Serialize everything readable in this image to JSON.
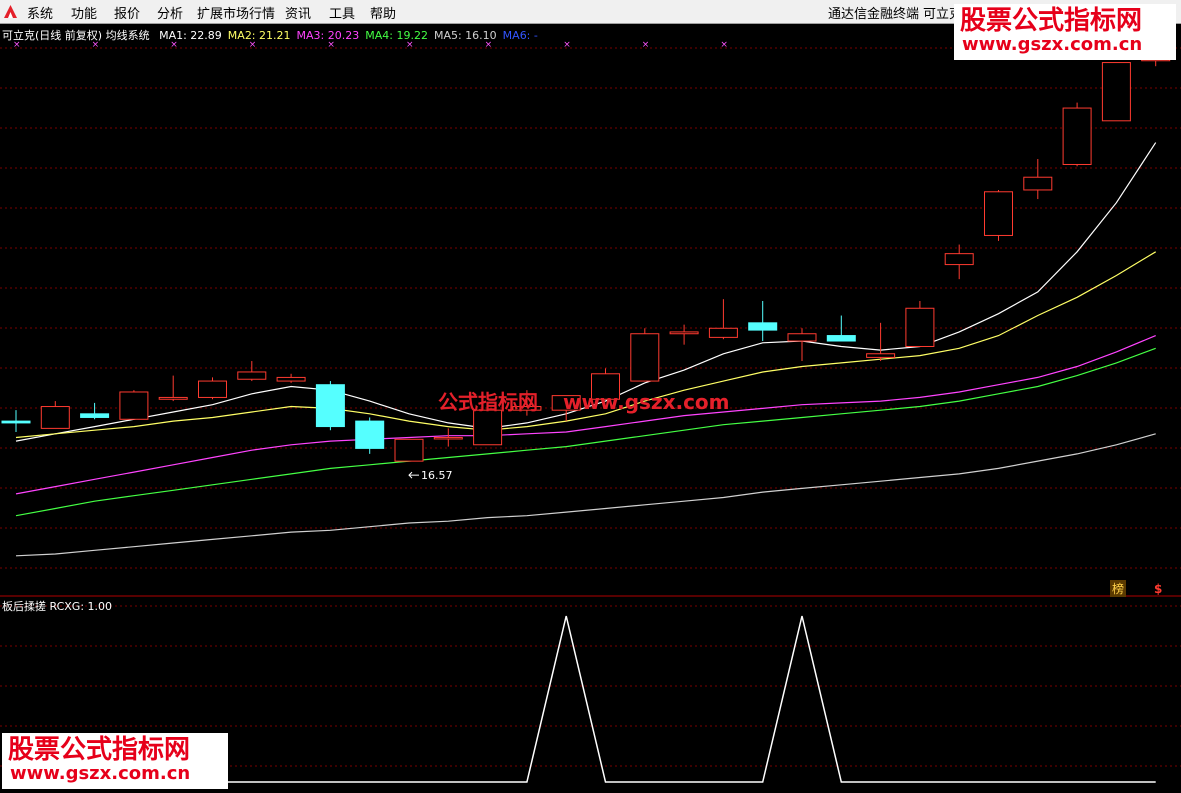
{
  "menu": {
    "items": [
      "系统",
      "功能",
      "报价",
      "分析",
      "扩展市场行情",
      "资讯",
      "工具",
      "帮助"
    ],
    "right_items": [
      "通达信金融终端",
      "可立克"
    ]
  },
  "main_panel": {
    "header_label": "可立克(日线 前复权) 均线系统",
    "ma_legend": [
      {
        "label": "MA1: 22.89",
        "color": "#ffffff"
      },
      {
        "label": "MA2: 21.21",
        "color": "#ffff66"
      },
      {
        "label": "MA3: 20.23",
        "color": "#ff44ff"
      },
      {
        "label": "MA4: 19.22",
        "color": "#44ff44"
      },
      {
        "label": "MA5: 16.10",
        "color": "#d0d0d0"
      },
      {
        "label": "MA6: -",
        "color": "#3355ff"
      }
    ],
    "low_annotation": "16.57",
    "badge_bang": "榜",
    "badge_s": "$"
  },
  "sub_panel": {
    "header_label": "板后揉搓  RCXG: 1.00"
  },
  "watermarks": {
    "title": "股票公式指标网",
    "url": "www.gszx.com.cn",
    "center_a": "公式指标网",
    "center_b": "www.gszx.com"
  },
  "colors": {
    "up": "#ff3b30",
    "down": "#55ffff",
    "grid": "#7a0000",
    "separator": "#b00000"
  },
  "chart_data": [
    {
      "type": "candlestick",
      "y_range": [
        15.0,
        30.0
      ],
      "candles": [
        {
          "o": 19.75,
          "h": 20.05,
          "l": 19.45,
          "c": 19.7
        },
        {
          "o": 19.55,
          "h": 20.3,
          "l": 19.55,
          "c": 20.15
        },
        {
          "o": 19.95,
          "h": 20.25,
          "l": 19.8,
          "c": 19.85
        },
        {
          "o": 19.8,
          "h": 20.6,
          "l": 19.8,
          "c": 20.55
        },
        {
          "o": 20.35,
          "h": 21.0,
          "l": 20.3,
          "c": 20.4
        },
        {
          "o": 20.4,
          "h": 20.95,
          "l": 20.35,
          "c": 20.85
        },
        {
          "o": 20.9,
          "h": 21.4,
          "l": 20.85,
          "c": 21.1
        },
        {
          "o": 20.85,
          "h": 21.05,
          "l": 20.8,
          "c": 20.95
        },
        {
          "o": 20.75,
          "h": 20.85,
          "l": 19.5,
          "c": 19.6
        },
        {
          "o": 19.75,
          "h": 19.85,
          "l": 18.85,
          "c": 19.0
        },
        {
          "o": 18.65,
          "h": 19.25,
          "l": 18.65,
          "c": 19.25
        },
        {
          "o": 19.3,
          "h": 19.55,
          "l": 19.05,
          "c": 19.3
        },
        {
          "o": 19.1,
          "h": 20.2,
          "l": 19.1,
          "c": 20.05
        },
        {
          "o": 20.05,
          "h": 20.6,
          "l": 19.9,
          "c": 20.15
        },
        {
          "o": 20.05,
          "h": 20.45,
          "l": 19.75,
          "c": 20.45
        },
        {
          "o": 20.35,
          "h": 21.2,
          "l": 20.35,
          "c": 21.05
        },
        {
          "o": 20.85,
          "h": 22.3,
          "l": 20.85,
          "c": 22.15
        },
        {
          "o": 22.15,
          "h": 22.4,
          "l": 21.85,
          "c": 22.2
        },
        {
          "o": 22.05,
          "h": 23.1,
          "l": 22.0,
          "c": 22.3
        },
        {
          "o": 22.45,
          "h": 23.05,
          "l": 21.95,
          "c": 22.25
        },
        {
          "o": 21.95,
          "h": 22.3,
          "l": 21.4,
          "c": 22.15
        },
        {
          "o": 22.1,
          "h": 22.65,
          "l": 22.0,
          "c": 21.95
        },
        {
          "o": 21.5,
          "h": 22.45,
          "l": 21.4,
          "c": 21.6
        },
        {
          "o": 21.8,
          "h": 23.05,
          "l": 21.8,
          "c": 22.85
        },
        {
          "o": 24.05,
          "h": 24.6,
          "l": 23.65,
          "c": 24.35
        },
        {
          "o": 24.85,
          "h": 26.1,
          "l": 24.7,
          "c": 26.05
        },
        {
          "o": 26.1,
          "h": 26.95,
          "l": 25.85,
          "c": 26.45
        },
        {
          "o": 26.8,
          "h": 28.5,
          "l": 26.75,
          "c": 28.35
        },
        {
          "o": 28.0,
          "h": 29.6,
          "l": 28.0,
          "c": 29.6
        },
        {
          "o": 29.65,
          "h": 30.7,
          "l": 29.5,
          "c": 30.15
        }
      ],
      "series": [
        {
          "name": "MA1",
          "color": "#ffffff",
          "values": [
            19.2,
            19.4,
            19.6,
            19.8,
            20.0,
            20.2,
            20.5,
            20.7,
            20.6,
            20.3,
            19.95,
            19.7,
            19.55,
            19.7,
            19.95,
            20.3,
            20.8,
            21.15,
            21.6,
            21.9,
            21.95,
            21.8,
            21.7,
            21.8,
            22.2,
            22.7,
            23.3,
            24.4,
            25.75,
            27.4
          ]
        },
        {
          "name": "MA2",
          "color": "#ffff66",
          "values": [
            19.3,
            19.4,
            19.5,
            19.6,
            19.75,
            19.85,
            20.0,
            20.15,
            20.1,
            19.95,
            19.75,
            19.6,
            19.5,
            19.6,
            19.75,
            19.95,
            20.3,
            20.6,
            20.85,
            21.1,
            21.25,
            21.35,
            21.45,
            21.55,
            21.75,
            22.1,
            22.65,
            23.15,
            23.75,
            24.4
          ]
        },
        {
          "name": "MA3",
          "color": "#ff44ff",
          "values": [
            17.75,
            17.95,
            18.15,
            18.35,
            18.55,
            18.75,
            18.95,
            19.1,
            19.2,
            19.25,
            19.3,
            19.35,
            19.35,
            19.4,
            19.45,
            19.6,
            19.75,
            19.9,
            20.0,
            20.1,
            20.2,
            20.25,
            20.3,
            20.4,
            20.55,
            20.75,
            20.95,
            21.25,
            21.65,
            22.1
          ]
        },
        {
          "name": "MA4",
          "color": "#44ff44",
          "values": [
            17.15,
            17.35,
            17.55,
            17.7,
            17.85,
            18.0,
            18.15,
            18.3,
            18.45,
            18.55,
            18.65,
            18.75,
            18.85,
            18.95,
            19.05,
            19.2,
            19.35,
            19.5,
            19.65,
            19.75,
            19.85,
            19.95,
            20.05,
            20.15,
            20.3,
            20.5,
            20.7,
            21.0,
            21.35,
            21.75
          ]
        },
        {
          "name": "MA5",
          "color": "#d0d0d0",
          "values": [
            16.05,
            16.1,
            16.2,
            16.3,
            16.4,
            16.5,
            16.6,
            16.7,
            16.75,
            16.85,
            16.95,
            17.0,
            17.1,
            17.15,
            17.25,
            17.35,
            17.45,
            17.55,
            17.65,
            17.8,
            17.9,
            18.0,
            18.1,
            18.2,
            18.3,
            18.45,
            18.65,
            18.85,
            19.1,
            19.4
          ]
        }
      ]
    },
    {
      "type": "line",
      "name": "RCXG",
      "y_range": [
        0,
        1
      ],
      "values": [
        0,
        0,
        0,
        0,
        0,
        0,
        0,
        0,
        0,
        0,
        0,
        0,
        0,
        0,
        1,
        0,
        0,
        0,
        0,
        0,
        1,
        0,
        0,
        0,
        0,
        0,
        0,
        0,
        0,
        0
      ]
    }
  ]
}
